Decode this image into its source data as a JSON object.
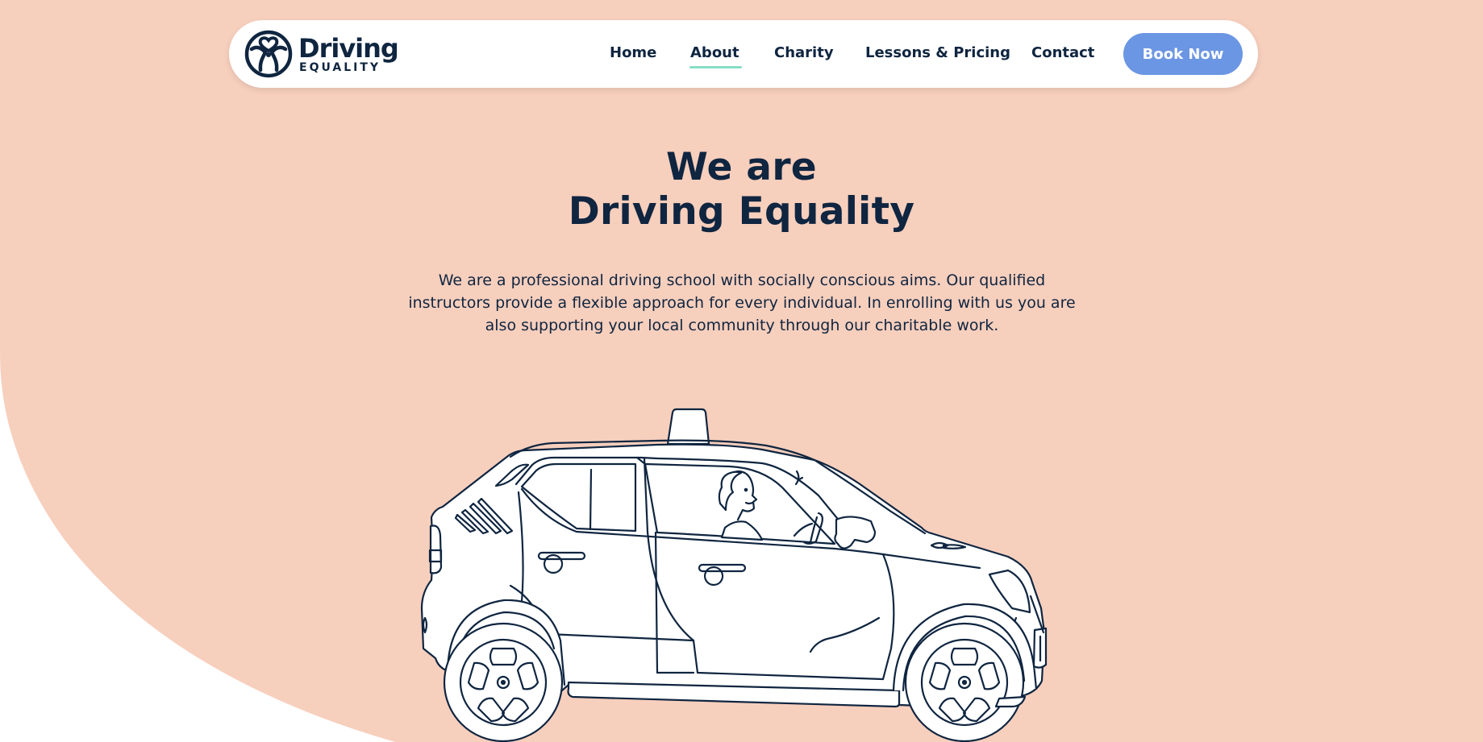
{
  "colors": {
    "peach_background": "#f7cfbd",
    "navy_text": "#0f2540",
    "accent_blue": "#6b96e3",
    "active_underline": "#86dfc4",
    "white": "#ffffff"
  },
  "header": {
    "logo": {
      "main": "Driving",
      "sub": "EQUALITY",
      "icon": "steering-wheel-heart-icon"
    },
    "nav": [
      {
        "label": "Home",
        "active": false
      },
      {
        "label": "About",
        "active": true
      },
      {
        "label": "Charity",
        "active": false
      },
      {
        "label": "Lessons & Pricing",
        "active": false
      },
      {
        "label": "Contact",
        "active": false
      }
    ],
    "cta_label": "Book Now"
  },
  "hero": {
    "title_line1": "We are",
    "title_line2": "Driving Equality",
    "paragraph_line1": "We are a professional driving school with socially conscious aims. Our qualified",
    "paragraph_line2": "instructors provide a flexible approach for every individual. In enrolling with us you are",
    "paragraph_line3": "also supporting your local community through our charitable work.",
    "illustration": "driving-school-car-illustration"
  }
}
